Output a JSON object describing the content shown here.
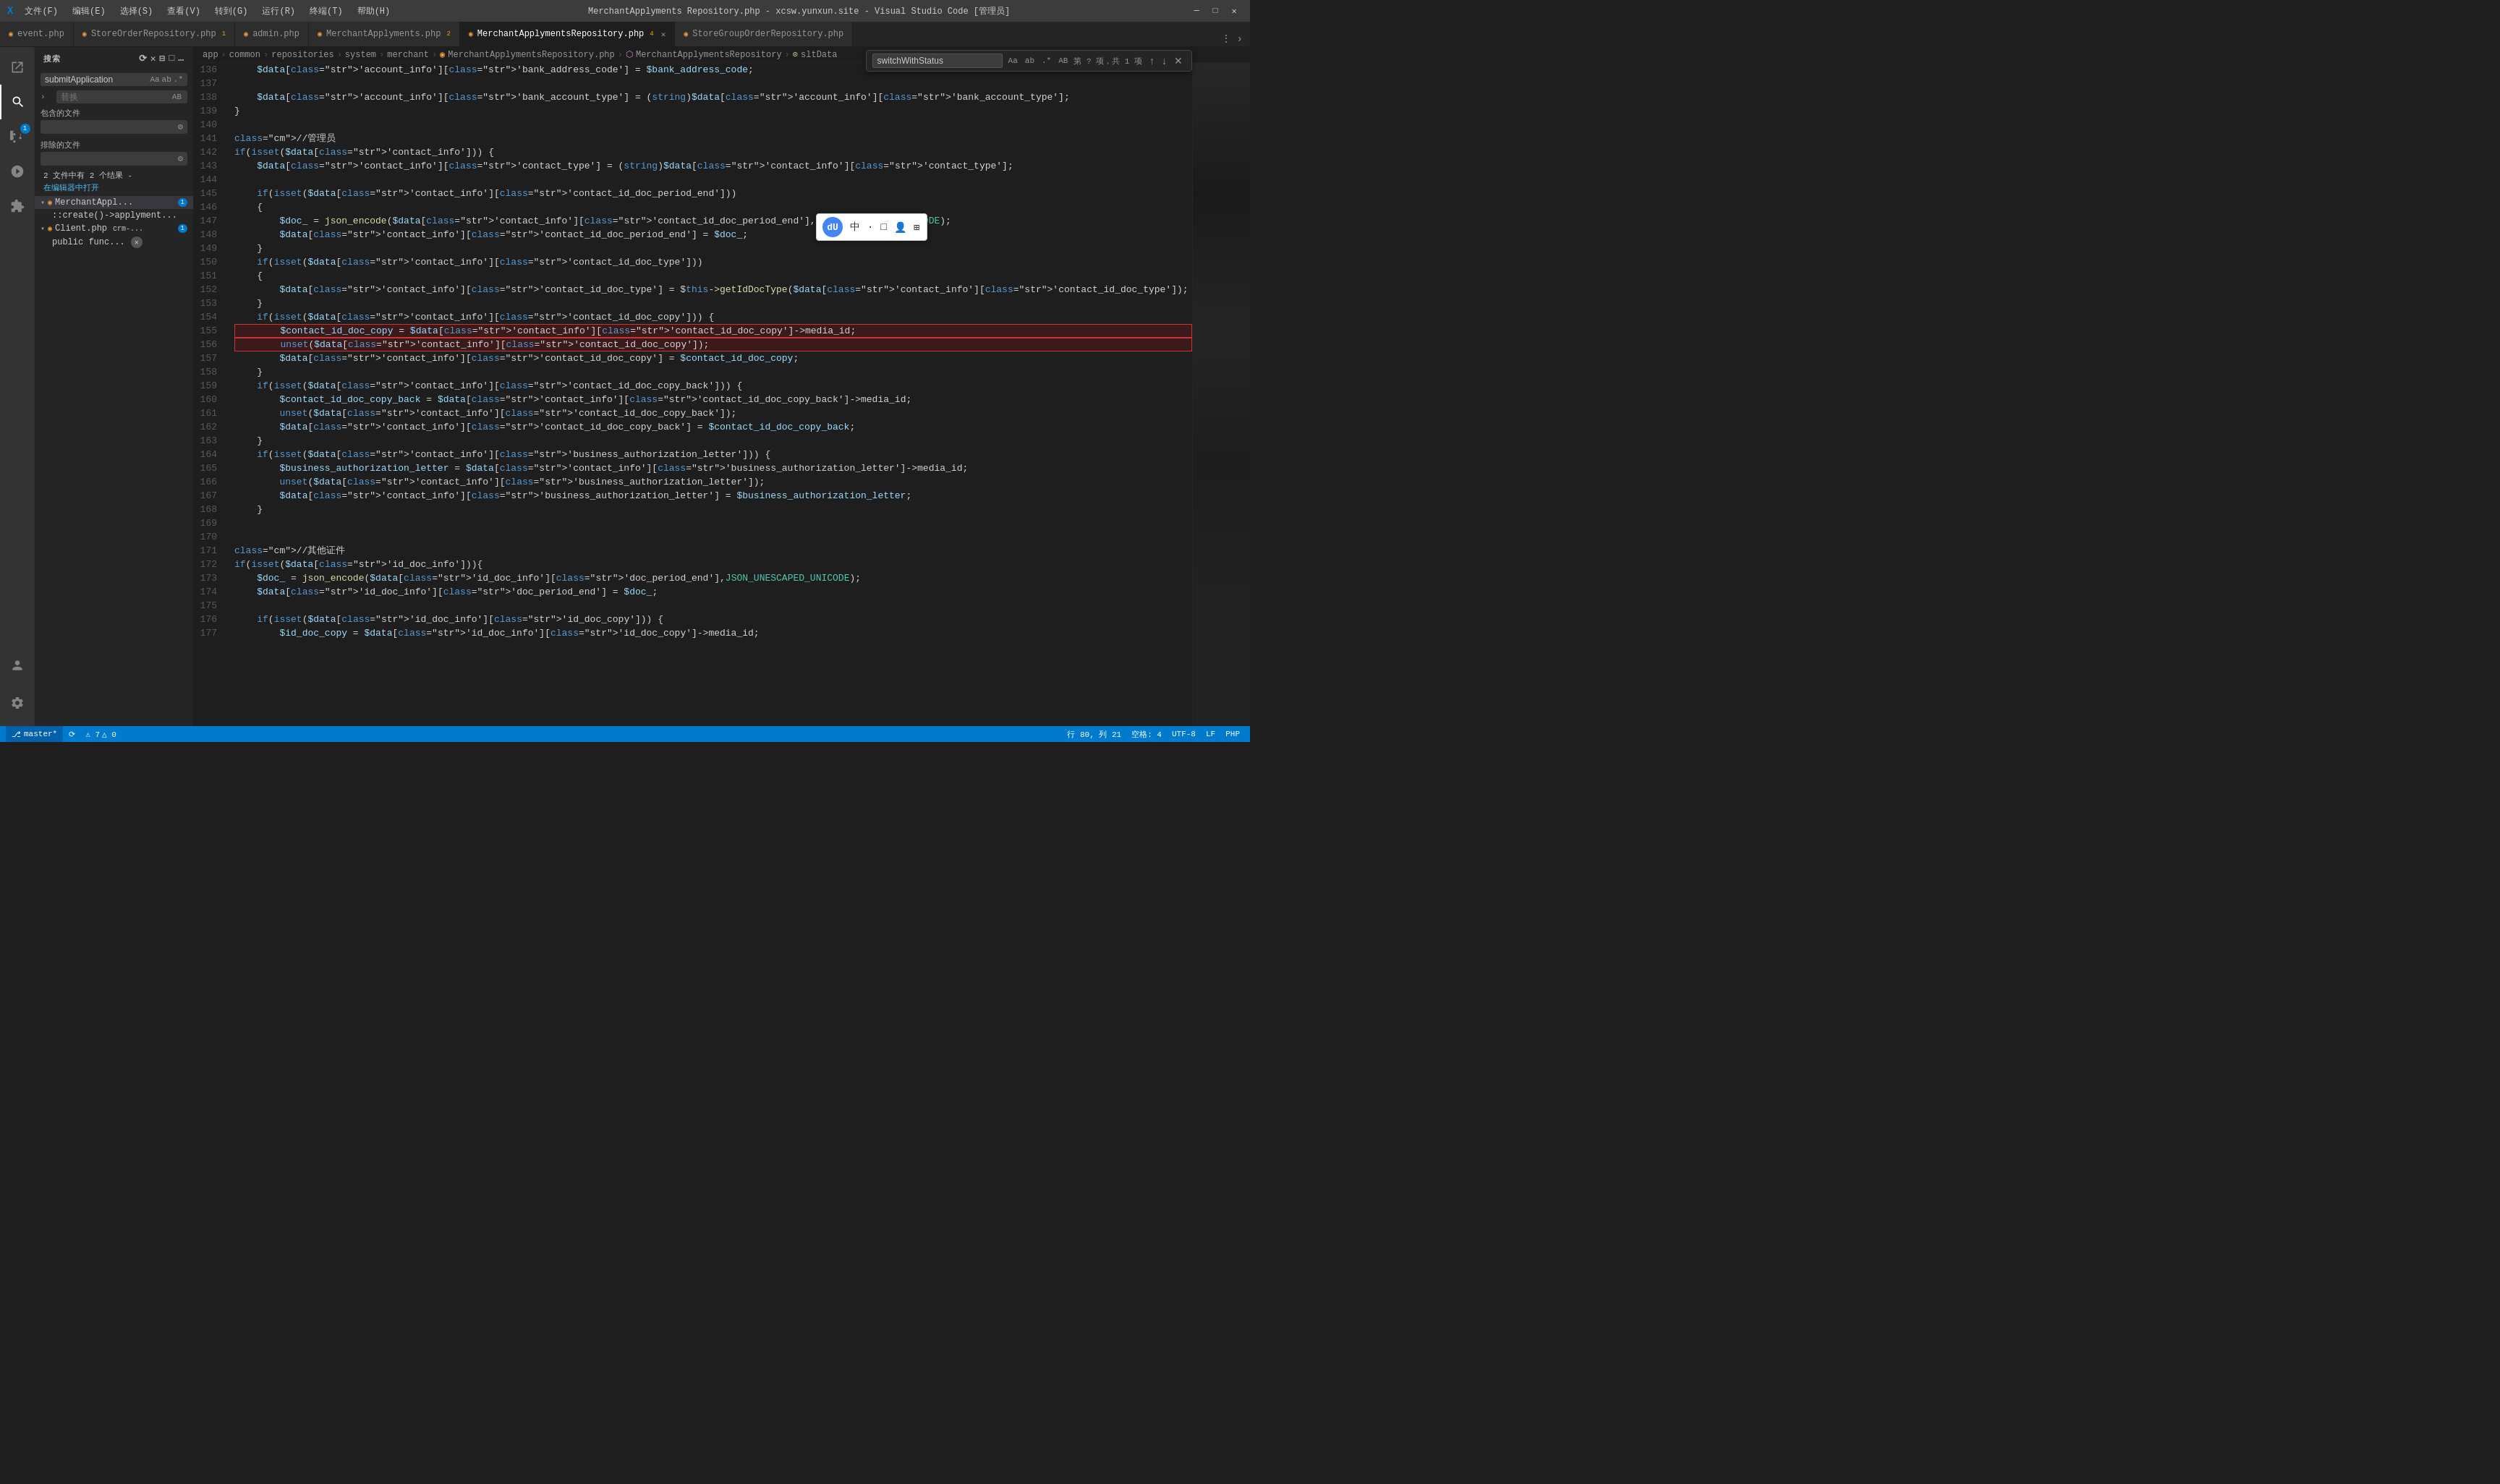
{
  "titlebar": {
    "icon": "X",
    "menu_items": [
      "文件(F)",
      "编辑(E)",
      "选择(S)",
      "查看(V)",
      "转到(G)",
      "运行(R)",
      "终端(T)",
      "帮助(H)"
    ],
    "title": "MerchantApplyments Repository.php - xcsw.yunxun.site - Visual Studio Code [管理员]",
    "controls": [
      "—",
      "□",
      "✕"
    ]
  },
  "tabs": [
    {
      "label": "event.php",
      "active": false,
      "dirty": false,
      "icon": "◉"
    },
    {
      "label": "StoreOrderRepository.php",
      "num": "1",
      "active": false,
      "dirty": false,
      "icon": "◉"
    },
    {
      "label": "admin.php",
      "active": false,
      "dirty": false,
      "icon": "◉"
    },
    {
      "label": "MerchantApplyments.php",
      "num": "2",
      "active": false,
      "dirty": false,
      "icon": "◉"
    },
    {
      "label": "MerchantApplymentsRepository.php",
      "num": "4",
      "active": true,
      "dirty": false,
      "icon": "◉"
    },
    {
      "label": "StoreGroupOrderRepository.php",
      "active": false,
      "dirty": false,
      "icon": "◉"
    }
  ],
  "breadcrumb": {
    "parts": [
      "app",
      "common",
      "repositories",
      "system",
      "merchant",
      "MerchantApplymentsRepository.php",
      "MerchantApplymentsRepository",
      "sltData"
    ]
  },
  "sidebar": {
    "title": "搜索",
    "search_placeholder": "submitApplication",
    "replace_label": "替换",
    "include_files": "包含的文件",
    "exclude_files": "排除的文件",
    "results_count": "2 文件中有 2 个结果 -",
    "open_in_editor": "在编辑器中打开",
    "file1": {
      "name": "MerchantAppl...",
      "badge": "1",
      "path": "::create()->applyment..."
    },
    "file2": {
      "name": "Client.php",
      "badge_text": "crm-...",
      "badge_count": "1",
      "sub": "public func..."
    }
  },
  "find_widget": {
    "placeholder": "switchWithStatus",
    "result_text": "第 ? 项，共 1 项",
    "up_icon": "↑",
    "down_icon": "↓",
    "close_icon": "✕"
  },
  "code_lines": [
    {
      "num": 136,
      "text": "    $data['account_info']['bank_address_code'] = $bank_address_code;"
    },
    {
      "num": 137,
      "text": ""
    },
    {
      "num": 138,
      "text": "    $data['account_info']['bank_account_type'] = (string)$data['account_info']['bank_account_type'];"
    },
    {
      "num": 139,
      "text": "}"
    },
    {
      "num": 140,
      "text": ""
    },
    {
      "num": 141,
      "text": "//管理员"
    },
    {
      "num": 142,
      "text": "if(isset($data['contact_info'])) {"
    },
    {
      "num": 143,
      "text": "    $data['contact_info']['contact_type'] = (string)$data['contact_info']['contact_type'];"
    },
    {
      "num": 144,
      "text": ""
    },
    {
      "num": 145,
      "text": "    if(isset($data['contact_info']['contact_id_doc_period_end']))"
    },
    {
      "num": 146,
      "text": "    {"
    },
    {
      "num": 147,
      "text": "        $doc_ = json_encode($data['contact_info']['contact_id_doc_period_end'],JSON_UNESCAPED_UNICODE);"
    },
    {
      "num": 148,
      "text": "        $data['contact_info']['contact_id_doc_period_end'] = $doc_;"
    },
    {
      "num": 149,
      "text": "    }"
    },
    {
      "num": 150,
      "text": "    if(isset($data['contact_info']['contact_id_doc_type']))"
    },
    {
      "num": 151,
      "text": "    {"
    },
    {
      "num": 152,
      "text": "        $data['contact_info']['contact_id_doc_type'] = $this->getIdDocType($data['contact_info']['contact_id_doc_type']);"
    },
    {
      "num": 153,
      "text": "    }"
    },
    {
      "num": 154,
      "text": "    if(isset($data['contact_info']['contact_id_doc_copy'])) {"
    },
    {
      "num": 155,
      "text": "        $contact_id_doc_copy = $data['contact_info']['contact_id_doc_copy']->media_id;",
      "highlight": "red"
    },
    {
      "num": 156,
      "text": "        unset($data['contact_info']['contact_id_doc_copy']);",
      "highlight": "red"
    },
    {
      "num": 157,
      "text": "        $data['contact_info']['contact_id_doc_copy'] = $contact_id_doc_copy;"
    },
    {
      "num": 158,
      "text": "    }"
    },
    {
      "num": 159,
      "text": "    if(isset($data['contact_info']['contact_id_doc_copy_back'])) {"
    },
    {
      "num": 160,
      "text": "        $contact_id_doc_copy_back = $data['contact_info']['contact_id_doc_copy_back']->media_id;"
    },
    {
      "num": 161,
      "text": "        unset($data['contact_info']['contact_id_doc_copy_back']);"
    },
    {
      "num": 162,
      "text": "        $data['contact_info']['contact_id_doc_copy_back'] = $contact_id_doc_copy_back;"
    },
    {
      "num": 163,
      "text": "    }"
    },
    {
      "num": 164,
      "text": "    if(isset($data['contact_info']['business_authorization_letter'])) {"
    },
    {
      "num": 165,
      "text": "        $business_authorization_letter = $data['contact_info']['business_authorization_letter']->media_id;"
    },
    {
      "num": 166,
      "text": "        unset($data['contact_info']['business_authorization_letter']);"
    },
    {
      "num": 167,
      "text": "        $data['contact_info']['business_authorization_letter'] = $business_authorization_letter;"
    },
    {
      "num": 168,
      "text": "    }"
    },
    {
      "num": 169,
      "text": ""
    },
    {
      "num": 170,
      "text": ""
    },
    {
      "num": 171,
      "text": "//其他证件"
    },
    {
      "num": 172,
      "text": "if(isset($data['id_doc_info'])){"
    },
    {
      "num": 173,
      "text": "    $doc_ = json_encode($data['id_doc_info']['doc_period_end'],JSON_UNESCAPED_UNICODE);"
    },
    {
      "num": 174,
      "text": "    $data['id_doc_info']['doc_period_end'] = $doc_;"
    },
    {
      "num": 175,
      "text": ""
    },
    {
      "num": 176,
      "text": "    if(isset($data['id_doc_info']['id_doc_copy'])) {"
    },
    {
      "num": 177,
      "text": "        $id_doc_copy = $data['id_doc_info']['id_doc_copy']->media_id;"
    }
  ],
  "statusbar": {
    "git_branch": "master*",
    "sync_icon": "⟳",
    "errors": "⚠ 7",
    "warnings": "△ 0",
    "line_col": "行 80, 列 21",
    "spaces": "空格: 4",
    "encoding": "UTF-8",
    "line_ending": "LF",
    "language": "PHP"
  }
}
